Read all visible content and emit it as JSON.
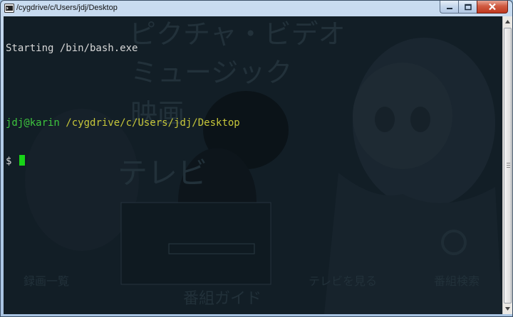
{
  "window": {
    "title": "/cygdrive/c/Users/jdj/Desktop",
    "controls": {
      "minimize": "minimize",
      "maximize": "maximize",
      "close": "close"
    }
  },
  "terminal": {
    "line1": "Starting /bin/bash.exe",
    "line2": "",
    "user_host": "jdj@karin",
    "cwd": "/cygdrive/c/Users/jdj/Desktop",
    "prompt": "$ "
  },
  "wallpaper": {
    "menu_pictures_video": "ピクチャ・ビデオ",
    "menu_music": "ミュージック",
    "menu_movies": "映画",
    "menu_tv": "テレビ",
    "menu_recorded": "録画一覧",
    "menu_watch_tv": "テレビを見る",
    "menu_search": "番組検索",
    "menu_guide": "番組ガイド"
  },
  "colors": {
    "terminal_bg": "#121e26",
    "text": "#d7d7d7",
    "user_host": "#3ec53e",
    "cwd": "#c7c73a",
    "cursor": "#18d418",
    "close_button": "#c0391f"
  }
}
